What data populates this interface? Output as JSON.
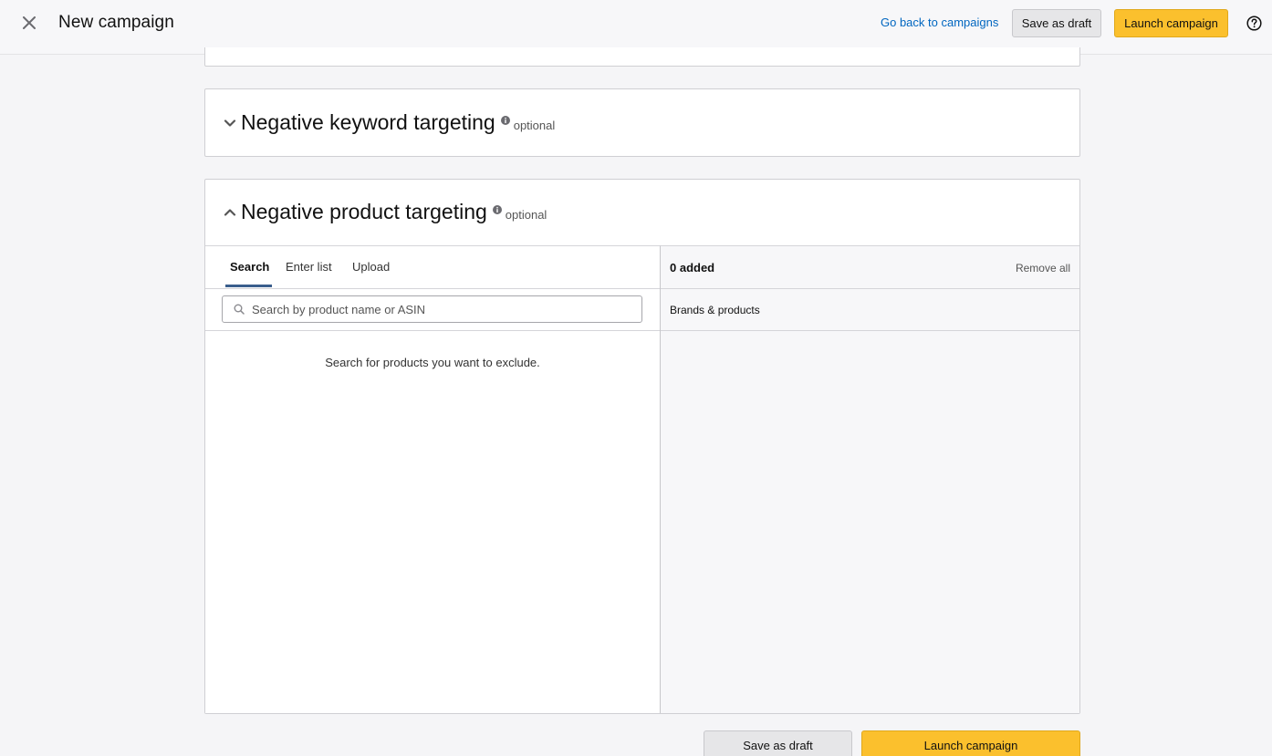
{
  "header": {
    "title": "New campaign",
    "back_link": "Go back to campaigns",
    "save_draft": "Save as draft",
    "launch": "Launch campaign"
  },
  "sections": {
    "negative_keyword": {
      "title": "Negative keyword targeting",
      "optional": "optional",
      "state": "collapsed"
    },
    "negative_product": {
      "title": "Negative product targeting",
      "optional": "optional",
      "state": "expanded",
      "tabs": [
        "Search",
        "Enter list",
        "Upload"
      ],
      "active_tab": "Search",
      "search_placeholder": "Search by product name or ASIN",
      "empty_message": "Search for products you want to exclude.",
      "added_count": "0 added",
      "remove_all": "Remove all",
      "column_header": "Brands & products"
    }
  },
  "footer": {
    "save_draft": "Save as draft",
    "launch": "Launch campaign"
  },
  "colors": {
    "accent_button": "#fbc02d",
    "link": "#0066c0",
    "tab_underline": "#3a5e8c"
  }
}
